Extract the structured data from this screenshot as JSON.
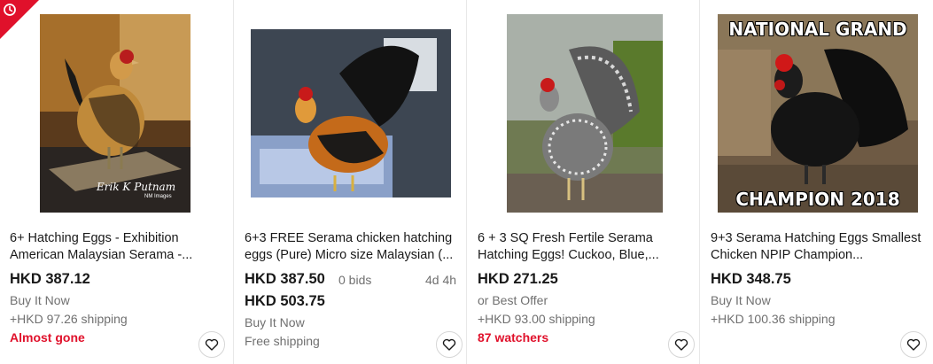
{
  "listings": [
    {
      "title": "6+ Hatching Eggs - Exhibition American Malaysian Serama -...",
      "price": "HKD 387.12",
      "format": "Buy It Now",
      "shipping": "+HKD 97.26 shipping",
      "alert": "Almost gone",
      "photo_watermark": "Erik K Putnam",
      "photo_watermark_sub": "NM Images",
      "colors": {
        "alert": "#e0112b"
      }
    },
    {
      "title": "6+3 FREE Serama chicken hatching eggs (Pure) Micro size Malaysian (...",
      "price": "HKD 387.50",
      "bids": "0 bids",
      "time_left": "4d 4h",
      "buy_now_price": "HKD 503.75",
      "format": "Buy It Now",
      "shipping": "Free shipping"
    },
    {
      "title": "6 + 3 SQ Fresh Fertile Serama Hatching Eggs! Cuckoo, Blue,...",
      "price": "HKD 271.25",
      "format": "or Best Offer",
      "shipping": "+HKD 93.00 shipping",
      "alert": "87 watchers"
    },
    {
      "title": "9+3 Serama Hatching Eggs Smallest Chicken NPIP Champion...",
      "price": "HKD 348.75",
      "format": "Buy It Now",
      "shipping": "+HKD 100.36 shipping",
      "photo_caption_top": "NATIONAL GRAND",
      "photo_caption_bottom": "CHAMPION 2018"
    }
  ],
  "icons": {
    "ribbon": "clock-icon",
    "watch": "heart-icon"
  }
}
